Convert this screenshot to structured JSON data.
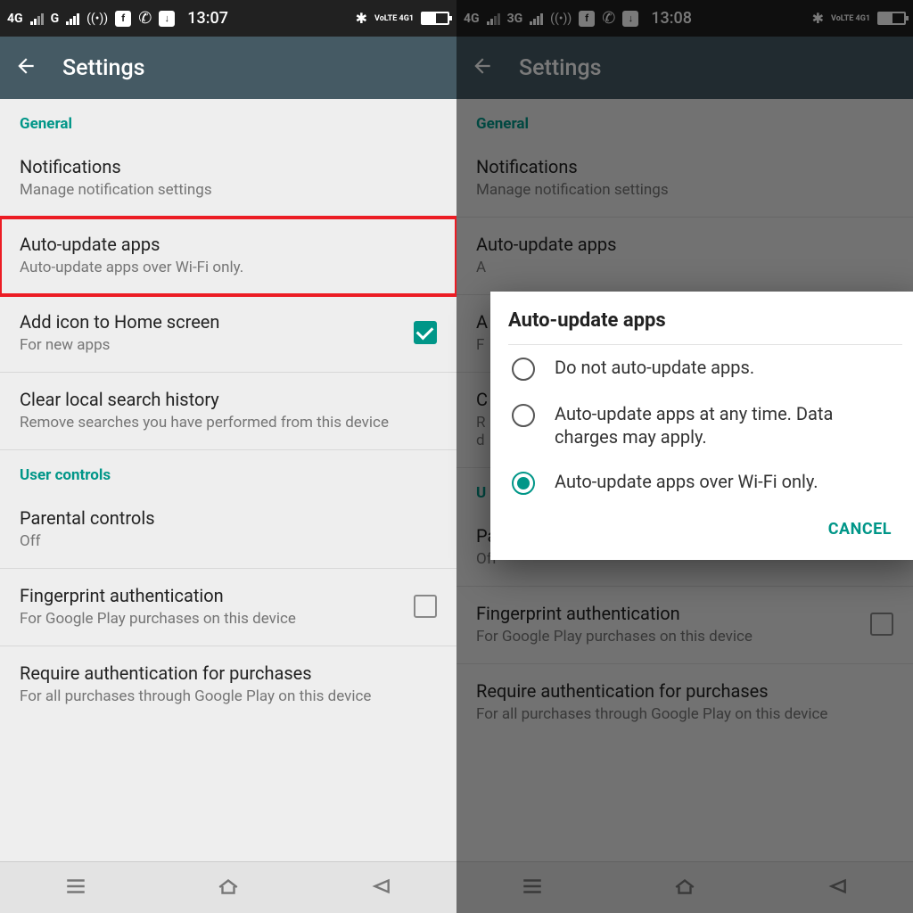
{
  "colors": {
    "teal": "#009688",
    "red": "#ec1c24",
    "header": "#455a64"
  },
  "left": {
    "status": {
      "net1": "4G",
      "net2": "G",
      "time": "13:07",
      "r_labels": "VoLTE 4G1"
    },
    "title": "Settings",
    "section1": "General",
    "notifications": {
      "title": "Notifications",
      "sub": "Manage notification settings"
    },
    "auto": {
      "title": "Auto-update apps",
      "sub": "Auto-update apps over Wi-Fi only."
    },
    "addicon": {
      "title": "Add icon to Home screen",
      "sub": "For new apps"
    },
    "clear": {
      "title": "Clear local search history",
      "sub": "Remove searches you have performed from this device"
    },
    "section2": "User controls",
    "parental": {
      "title": "Parental controls",
      "sub": "Off"
    },
    "finger": {
      "title": "Fingerprint authentication",
      "sub": "For Google Play purchases on this device"
    },
    "require": {
      "title": "Require authentication for purchases",
      "sub": "For all purchases through Google Play on this device"
    }
  },
  "right": {
    "status": {
      "net1": "4G",
      "net2": "3G",
      "time": "13:08",
      "r_labels": "VoLTE 4G1"
    },
    "title": "Settings",
    "section1": "General",
    "notifications": {
      "title": "Notifications",
      "sub": "Manage notification settings"
    },
    "auto": {
      "title": "Auto-update apps",
      "sub": "A"
    },
    "addicon": {
      "title": "A",
      "sub": "F"
    },
    "clear": {
      "title": "C",
      "sub": "R\nd"
    },
    "section2": "U",
    "parental": {
      "title": "Parental controls",
      "sub": "Off"
    },
    "finger": {
      "title": "Fingerprint authentication",
      "sub": "For Google Play purchases on this device"
    },
    "require": {
      "title": "Require authentication for purchases",
      "sub": "For all purchases through Google Play on this device"
    },
    "dialog": {
      "title": "Auto-update apps",
      "opt1": "Do not auto-update apps.",
      "opt2": "Auto-update apps at any time. Data charges may apply.",
      "opt3": "Auto-update apps over Wi-Fi only.",
      "cancel": "CANCEL"
    }
  }
}
